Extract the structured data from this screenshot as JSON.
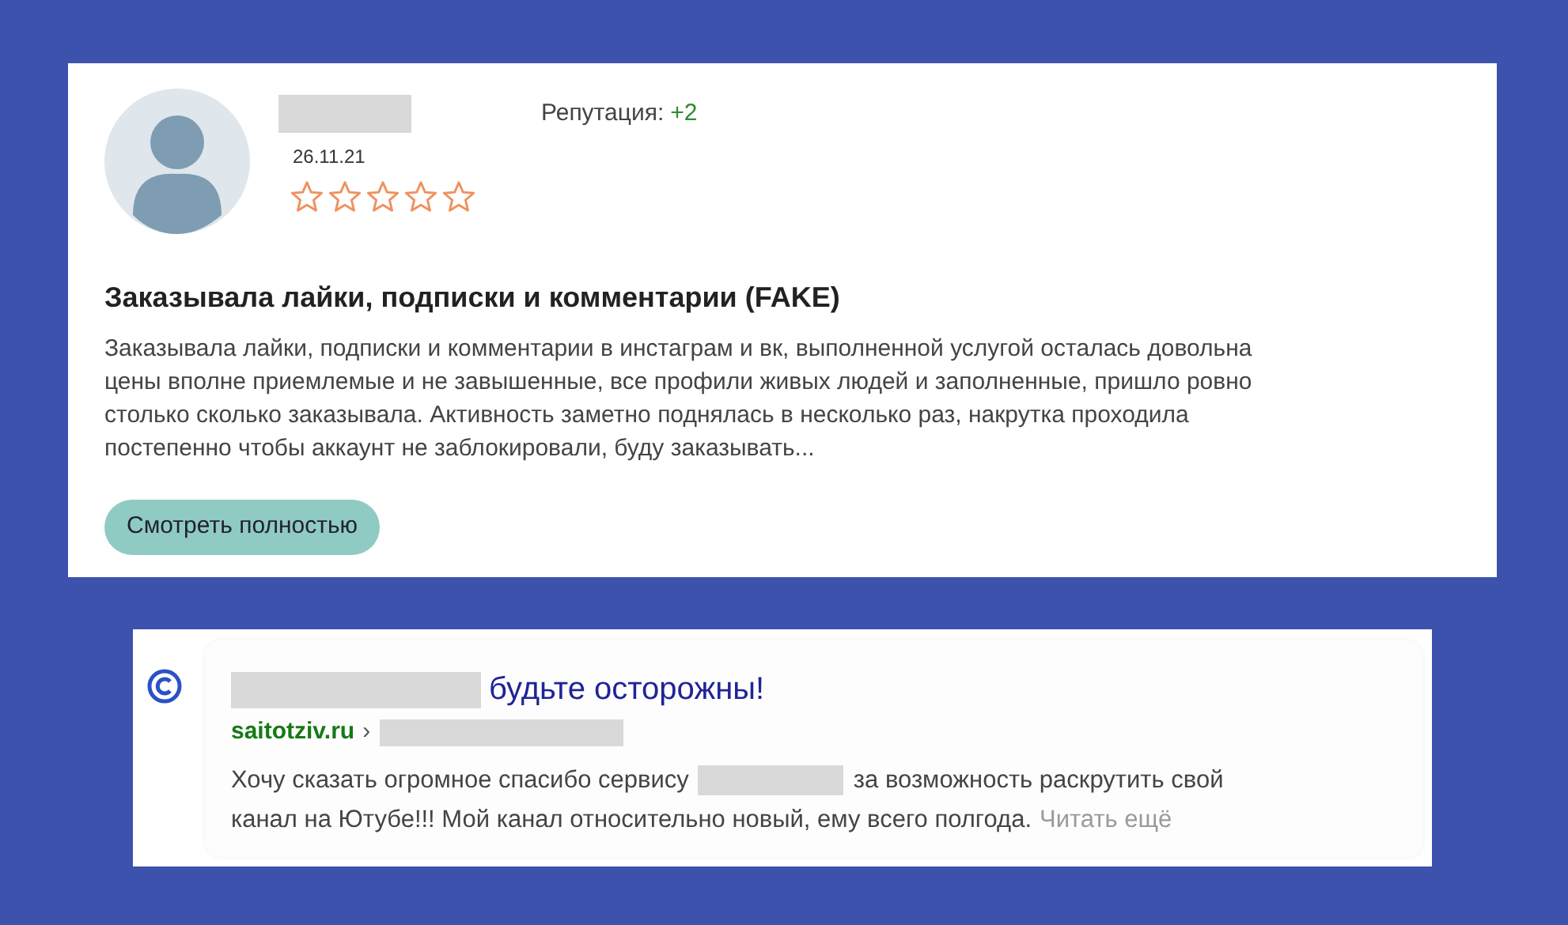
{
  "review": {
    "date": "26.11.21",
    "stars": 0,
    "reputation_label": "Репутация:",
    "reputation_value": "+2",
    "title": "Заказывала лайки, подписки и комментарии (FAKE)",
    "body_lines": [
      "Заказывала лайки, подписки и комментарии в инстаграм и вк, выполненной услугой осталась довольна",
      "цены вполне приемлемые и не завышенные, все профили живых людей и заполненные, пришло ровно",
      "столько сколько заказывала. Активность заметно поднялась в несколько раз, накрутка проходила",
      "постепенно чтобы аккаунт не заблокировали, буду заказывать..."
    ],
    "button": "Смотреть полностью"
  },
  "search_result": {
    "title": "будьте осторожны!",
    "domain": "saitotziv.ru",
    "separator": "›",
    "snippet_start": "Хочу сказать огромное спасибо сервису",
    "snippet_line1_end": "за возможность раскрутить свой",
    "snippet_line2": "канал на Ютубе!!! Мой канал относительно новый, ему всего полгода.",
    "read_more": "Читать ещё"
  }
}
